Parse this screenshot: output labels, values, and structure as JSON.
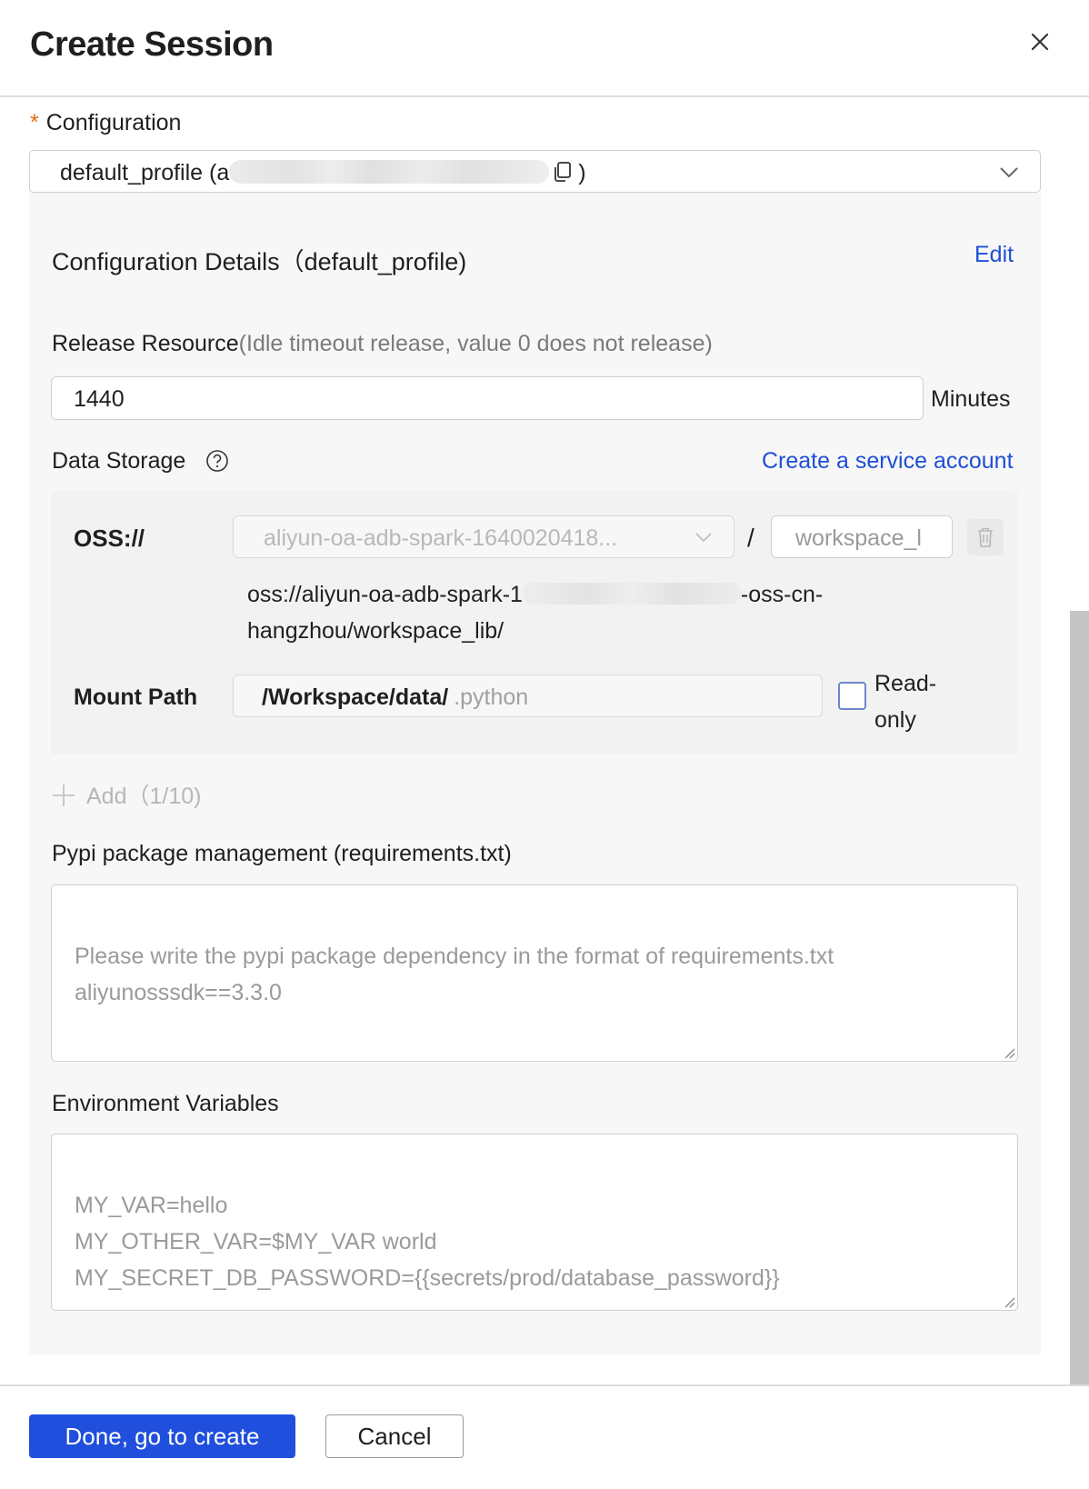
{
  "dialog": {
    "title": "Create Session",
    "close_icon": "close-icon"
  },
  "configuration": {
    "required_mark": "*",
    "label": "Configuration",
    "selected_prefix": "default_profile (a",
    "selected_suffix": ")",
    "copy_icon": "copy-icon",
    "dropdown_icon": "chevron-down-icon"
  },
  "details": {
    "title": "Configuration Details（default_profile)",
    "edit_label": "Edit",
    "release": {
      "label": "Release Resource",
      "hint": "(Idle timeout release, value 0 does not release)",
      "value": "1440",
      "unit": "Minutes"
    },
    "data_storage": {
      "label": "Data Storage",
      "help_icon": "question-circle-icon",
      "create_account_link": "Create a service account",
      "oss_label": "OSS://",
      "bucket_value": "aliyun-oa-adb-spark-1640020418...",
      "separator": "/",
      "path_value": "workspace_l",
      "delete_icon": "trash-icon",
      "full_path_prefix": "oss://aliyun-oa-adb-spark-1",
      "full_path_suffix": "-oss-cn-hangzhou/workspace_lib/",
      "mount_label": "Mount Path",
      "mount_prefix": "/Workspace/data/",
      "mount_placeholder": ".python",
      "readonly_label": "Read-only",
      "readonly_checked": false,
      "add_label": "Add（1/10)",
      "add_icon": "plus-icon"
    },
    "pypi": {
      "label": "Pypi package management (requirements.txt)",
      "placeholder": "Please write the pypi package dependency in the format of requirements.txt\naliyunosssdk==3.3.0"
    },
    "env": {
      "label": "Environment Variables",
      "placeholder": "MY_VAR=hello\nMY_OTHER_VAR=$MY_VAR world\nMY_SECRET_DB_PASSWORD={{secrets/prod/database_password}}"
    }
  },
  "footer": {
    "primary_label": "Done, go to create",
    "cancel_label": "Cancel"
  },
  "colors": {
    "accent": "#1f4fdc",
    "link": "#1e4fd6",
    "required": "#e0701a"
  }
}
